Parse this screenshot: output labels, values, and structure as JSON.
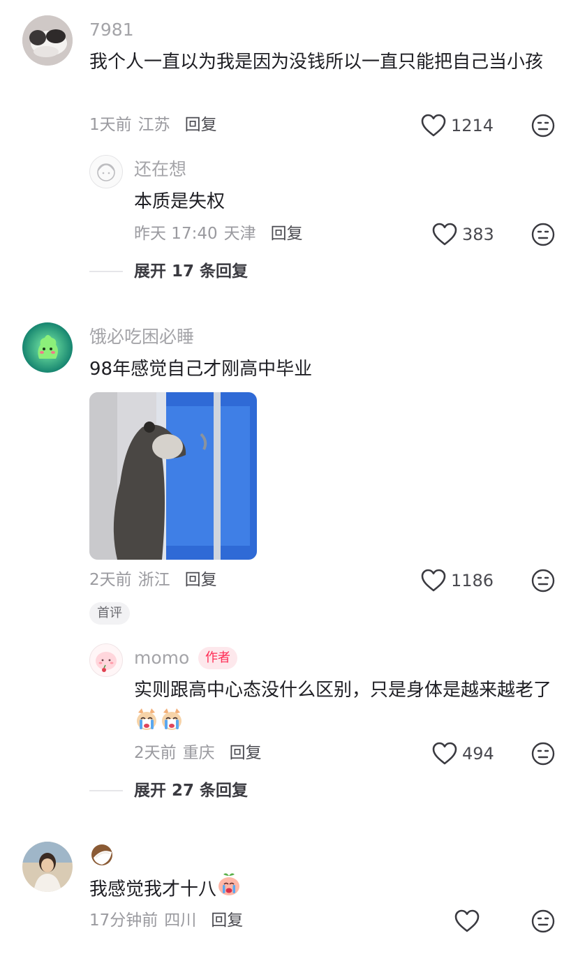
{
  "comments": [
    {
      "username": "7981",
      "text": "我个人一直以为我是因为没钱所以一直只能把自己当小孩",
      "time": "1天前",
      "location": "江苏",
      "reply_label": "回复",
      "likes": "1214",
      "replies": [
        {
          "username": "还在想",
          "text": "本质是失权",
          "time": "昨天 17:40",
          "location": "天津",
          "reply_label": "回复",
          "likes": "383"
        }
      ],
      "expand_label": "展开 17 条回复"
    },
    {
      "username": "饿必吃困必睡",
      "text": "98年感觉自己才刚高中毕业",
      "time": "2天前",
      "location": "浙江",
      "reply_label": "回复",
      "likes": "1186",
      "badge": "首评",
      "replies": [
        {
          "username": "momo",
          "author_badge": "作者",
          "text": "实则跟高中心态没什么区别，只是身体是越来越老了",
          "time": "2天前",
          "location": "重庆",
          "reply_label": "回复",
          "likes": "494"
        }
      ],
      "expand_label": "展开 27 条回复"
    },
    {
      "username_icon": "coconut-emoji",
      "text": "我感觉我才十八",
      "time": "17分钟前",
      "location": "四川",
      "reply_label": "回复"
    }
  ],
  "icons": [
    "heart-icon",
    "dislike-face-icon",
    "crying-dog-emoji",
    "crying-peach-emoji"
  ],
  "colors": {
    "author_badge": "#fe2c55",
    "username": "#a4a4a8",
    "text": "#1e1e23"
  }
}
